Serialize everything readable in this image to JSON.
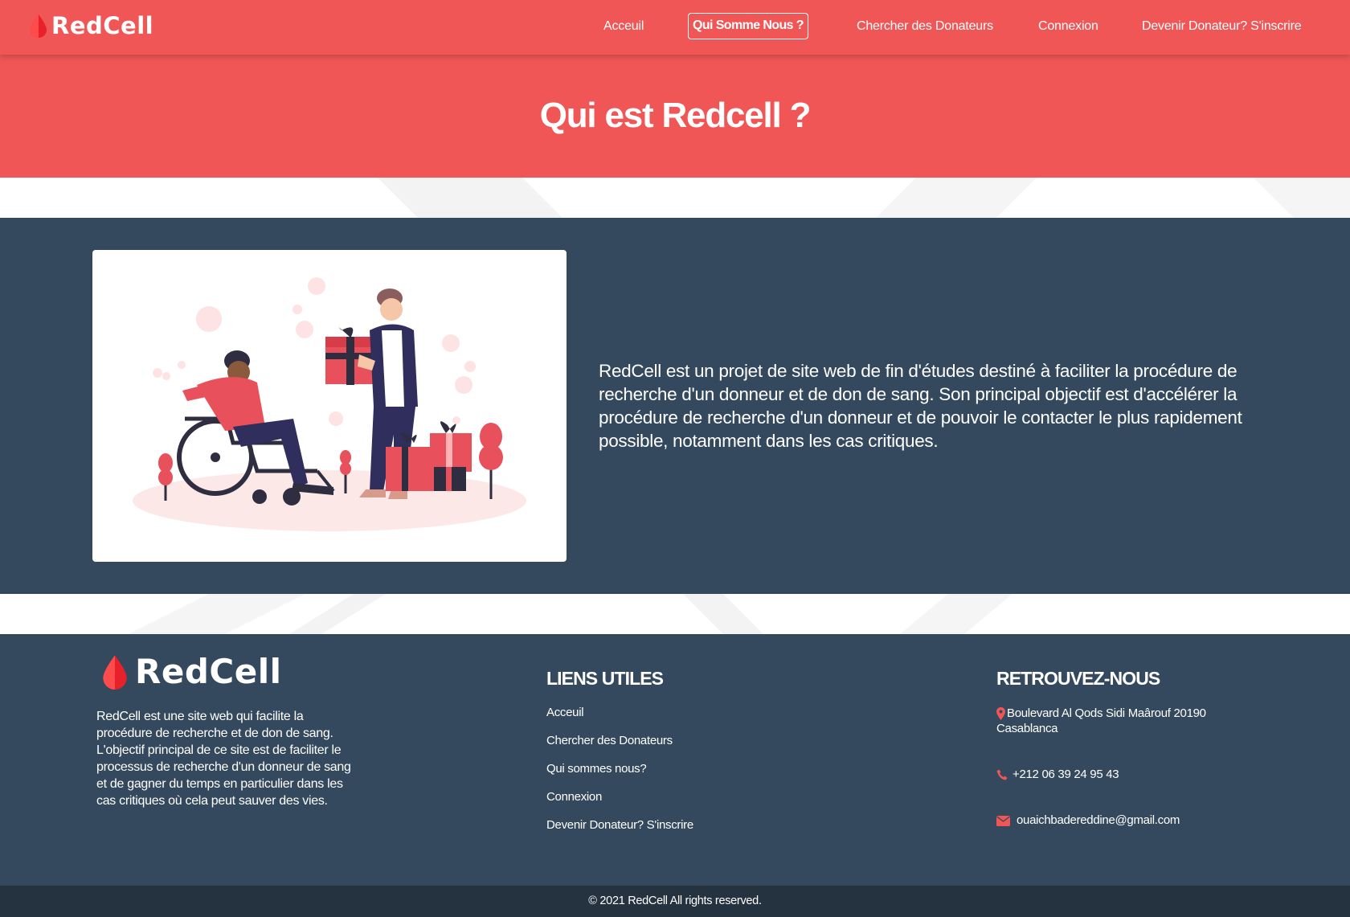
{
  "navbar": {
    "brand": "RedCell",
    "items": [
      {
        "label": "Acceuil"
      },
      {
        "label": "Qui Somme Nous ?"
      },
      {
        "label": "Chercher des Donateurs"
      },
      {
        "label": "Connexion"
      },
      {
        "label": "Devenir Donateur? S'inscrire"
      }
    ]
  },
  "hero": {
    "title": "Qui est Redcell ?"
  },
  "about": {
    "text": "RedCell est un projet de site web de fin d'études destiné à faciliter la procédure de recherche d'un donneur et de don de sang. Son principal objectif est d'accélérer la procédure de recherche d'un donneur et de pouvoir le contacter le plus rapidement possible, notamment dans les cas critiques."
  },
  "footer": {
    "brand": "RedCell",
    "description": "RedCell est une site web qui facilite la procédure de recherche et de don de sang. L'objectif principal de ce site est de faciliter le processus de recherche d'un donneur de sang et de gagner du temps en particulier dans les cas critiques où cela peut sauver des vies.",
    "links_heading": "LIENS UTILES",
    "links": [
      {
        "label": "Acceuil"
      },
      {
        "label": "Chercher des Donateurs"
      },
      {
        "label": "Qui sommes nous?"
      },
      {
        "label": "Connexion"
      },
      {
        "label": "Devenir Donateur? S'inscrire"
      }
    ],
    "contact_heading": "RETROUVEZ-NOUS",
    "address": "Boulevard Al Qods Sidi Maârouf 20190 Casablanca",
    "phone": "+212 06 39 24 95 43",
    "email": "ouaichbadereddine@gmail.com",
    "icons": {
      "address": "map-pin-icon",
      "phone": "phone-icon",
      "email": "envelope-icon"
    }
  },
  "copyright": "© 2021 RedCell All rights reserved.",
  "colors": {
    "primary_red": "#f05656",
    "navy": "#34495e",
    "dark_bar": "#253240",
    "accent_navy": "#2f2e5c"
  }
}
